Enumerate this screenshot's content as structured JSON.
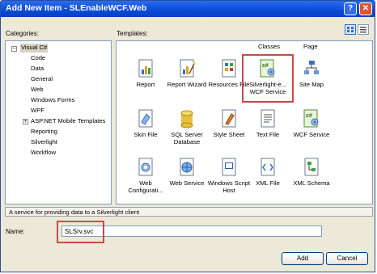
{
  "window": {
    "title": "Add New Item - SLEnableWCF.Web",
    "help_glyph": "?",
    "close_glyph": "✕"
  },
  "categories": {
    "label": "Categories:",
    "root": "Visual C#",
    "items": [
      "Code",
      "Data",
      "General",
      "Web",
      "Windows Forms",
      "WPF",
      "ASP.NET Mobile Templates",
      "Reporting",
      "Silverlight",
      "Workflow"
    ]
  },
  "templates": {
    "label": "Templates:",
    "truncated_labels": [
      "Classes",
      "Page"
    ],
    "items": [
      {
        "caption": "Report",
        "icon": "report-icon"
      },
      {
        "caption": "Report Wizard",
        "icon": "report-wizard-icon"
      },
      {
        "caption": "Resources File",
        "icon": "resources-file-icon"
      },
      {
        "caption": "Silverlight-e... WCF Service",
        "icon": "csharp-wcf-icon"
      },
      {
        "caption": "Site Map",
        "icon": "site-map-icon"
      },
      {
        "caption": "Skin File",
        "icon": "skin-file-icon"
      },
      {
        "caption": "SQL Server Database",
        "icon": "database-icon"
      },
      {
        "caption": "Style Sheet",
        "icon": "style-sheet-icon"
      },
      {
        "caption": "Text File",
        "icon": "text-file-icon"
      },
      {
        "caption": "WCF Service",
        "icon": "csharp-wcf-icon"
      },
      {
        "caption": "Web Configurati...",
        "icon": "web-config-icon"
      },
      {
        "caption": "Web Service",
        "icon": "web-service-icon"
      },
      {
        "caption": "Windows Script Host",
        "icon": "script-host-icon"
      },
      {
        "caption": "XML File",
        "icon": "xml-file-icon"
      },
      {
        "caption": "XML Schema",
        "icon": "xml-schema-icon"
      }
    ]
  },
  "description": "A service for providing data to a Silverlight client",
  "name": {
    "label": "Name:",
    "value": "SLSrv.svc"
  },
  "buttons": {
    "add": "Add",
    "cancel": "Cancel"
  },
  "colors": {
    "title_bar": "#0a4ad6",
    "highlight": "#c84a4a",
    "dialog_bg": "#ece9d8"
  }
}
